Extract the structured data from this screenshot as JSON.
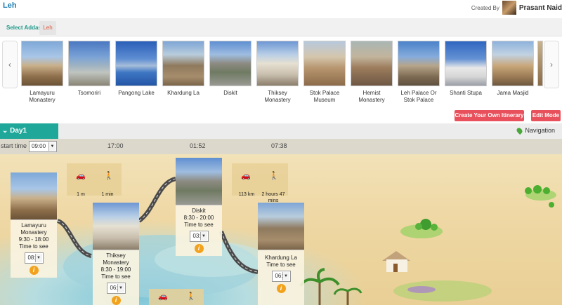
{
  "header": {
    "title": "Leh",
    "created_by_label": "Created By",
    "creator_name": "Prasant Naid"
  },
  "addas": {
    "label": "Select Addas",
    "selected_tab": "Leh"
  },
  "carousel": {
    "places": [
      {
        "name": "Lamayuru Monastery"
      },
      {
        "name": "Tsomoriri"
      },
      {
        "name": "Pangong Lake"
      },
      {
        "name": "Khardung La"
      },
      {
        "name": "Diskit"
      },
      {
        "name": "Thiksey Monastery"
      },
      {
        "name": "Stok Palace Museum"
      },
      {
        "name": "Hemist Monastery"
      },
      {
        "name": "Leh Palace Or Stok Palace"
      },
      {
        "name": "Shanti Stupa"
      },
      {
        "name": "Jama Masjid"
      }
    ]
  },
  "actions": {
    "create_itinerary": "Create Your Own Itinerary",
    "edit_mode": "Edit Mode"
  },
  "day": {
    "label": "Day1",
    "navigation": "Navigation",
    "start_time_label": "start time",
    "start_time_value": "09:00",
    "time_marks": [
      "17:00",
      "01:52",
      "07:38"
    ]
  },
  "stops": [
    {
      "name": "Lamayuru Monastery",
      "hours": "9:30 - 18:00",
      "see_label": "Time to see",
      "duration": "08:00"
    },
    {
      "name": "Thiksey Monastery",
      "hours": "8:30 - 19:00",
      "see_label": "Time to see",
      "duration": "06:00"
    },
    {
      "name": "Diskit",
      "hours": "8:30 - 20:00",
      "see_label": "Time to see",
      "duration": "03:00"
    },
    {
      "name": "Khardung La",
      "hours": "",
      "see_label": "Time to see",
      "duration": "06:00"
    }
  ],
  "travel": [
    {
      "distance": "1 m",
      "time": "1 min"
    },
    {
      "distance": "113 km",
      "time": "2 hours 47 mins"
    }
  ],
  "colors": {
    "accent_teal": "#1fa89a",
    "button_red": "#e8505b",
    "title_blue": "#1f7fb0"
  }
}
